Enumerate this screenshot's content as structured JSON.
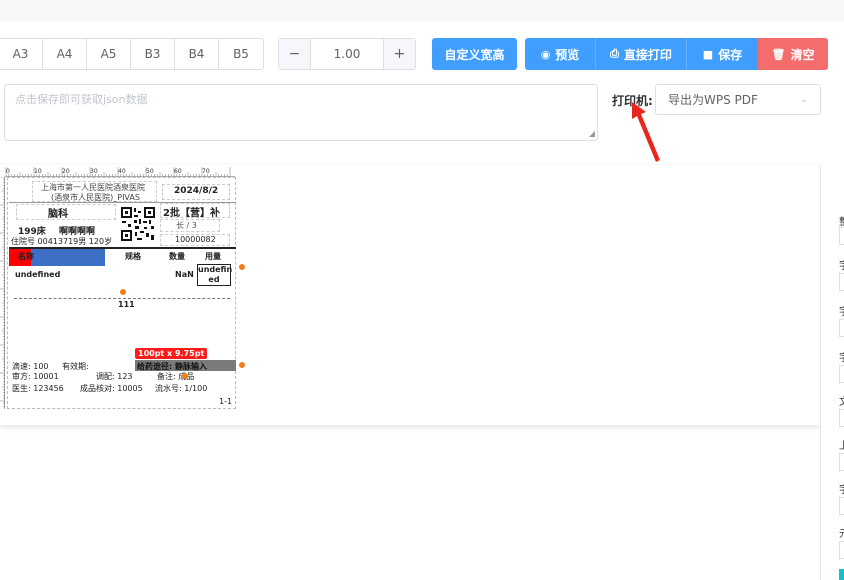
{
  "toolbar": {
    "paper_sizes": [
      "A3",
      "A4",
      "A5",
      "B3",
      "B4",
      "B5"
    ],
    "zoom": {
      "minus": "−",
      "value": "1.00",
      "plus": "+"
    },
    "custom_size_label": "自定义宽高",
    "preview_label": "预览",
    "print_label": "直接打印",
    "save_label": "保存",
    "clear_label": "清空"
  },
  "json_box": {
    "placeholder": "点击保存即可获取json数据"
  },
  "printer": {
    "label": "打印机:",
    "selected": "导出为WPS PDF"
  },
  "label": {
    "hospital_line1": "上海市第一人民医院酒泉医院",
    "hospital_line2": "(酒泉市人民医院)_PIVAS",
    "date": "2024/8/2",
    "dept": "脑科",
    "batch": "2批【营】补",
    "bed": "199床",
    "patient_name": "啊啊啊啊",
    "page_info": "长 / 3",
    "admission": "住院号 00413719男 120岁",
    "barcode_no": "10000082",
    "table_headers": [
      "名称",
      "规格",
      "数量",
      "用量"
    ],
    "row_name": "undefined",
    "row_qty": "NaN",
    "row_dose": "undefin ed",
    "center_text": "111",
    "size_badge": "100pt x 9.75pt",
    "drip_rate": "滴速: 100",
    "expiry": "有效期:",
    "route": "给药途径: 静脉输入",
    "prescriber": "审方: 10001",
    "dispenser": "调配: 123",
    "remark": "备注: 成品",
    "doctor": "医生: 123456",
    "checker": "成品核对: 10005",
    "serial": "流水号: 1/100",
    "page_num": "1-1"
  },
  "ruler": {
    "ticks": [
      "0",
      "10",
      "20",
      "30",
      "40",
      "50",
      "60",
      "70"
    ]
  },
  "right_panel": {
    "chars": [
      "整",
      "字",
      "字",
      "字",
      "文",
      "上",
      "字",
      "元"
    ]
  },
  "colors": {
    "primary": "#409eff",
    "danger": "#f56c6c",
    "header_bar": "#3c6fc5",
    "marker": "#ff0000",
    "dot": "#f07e14"
  }
}
